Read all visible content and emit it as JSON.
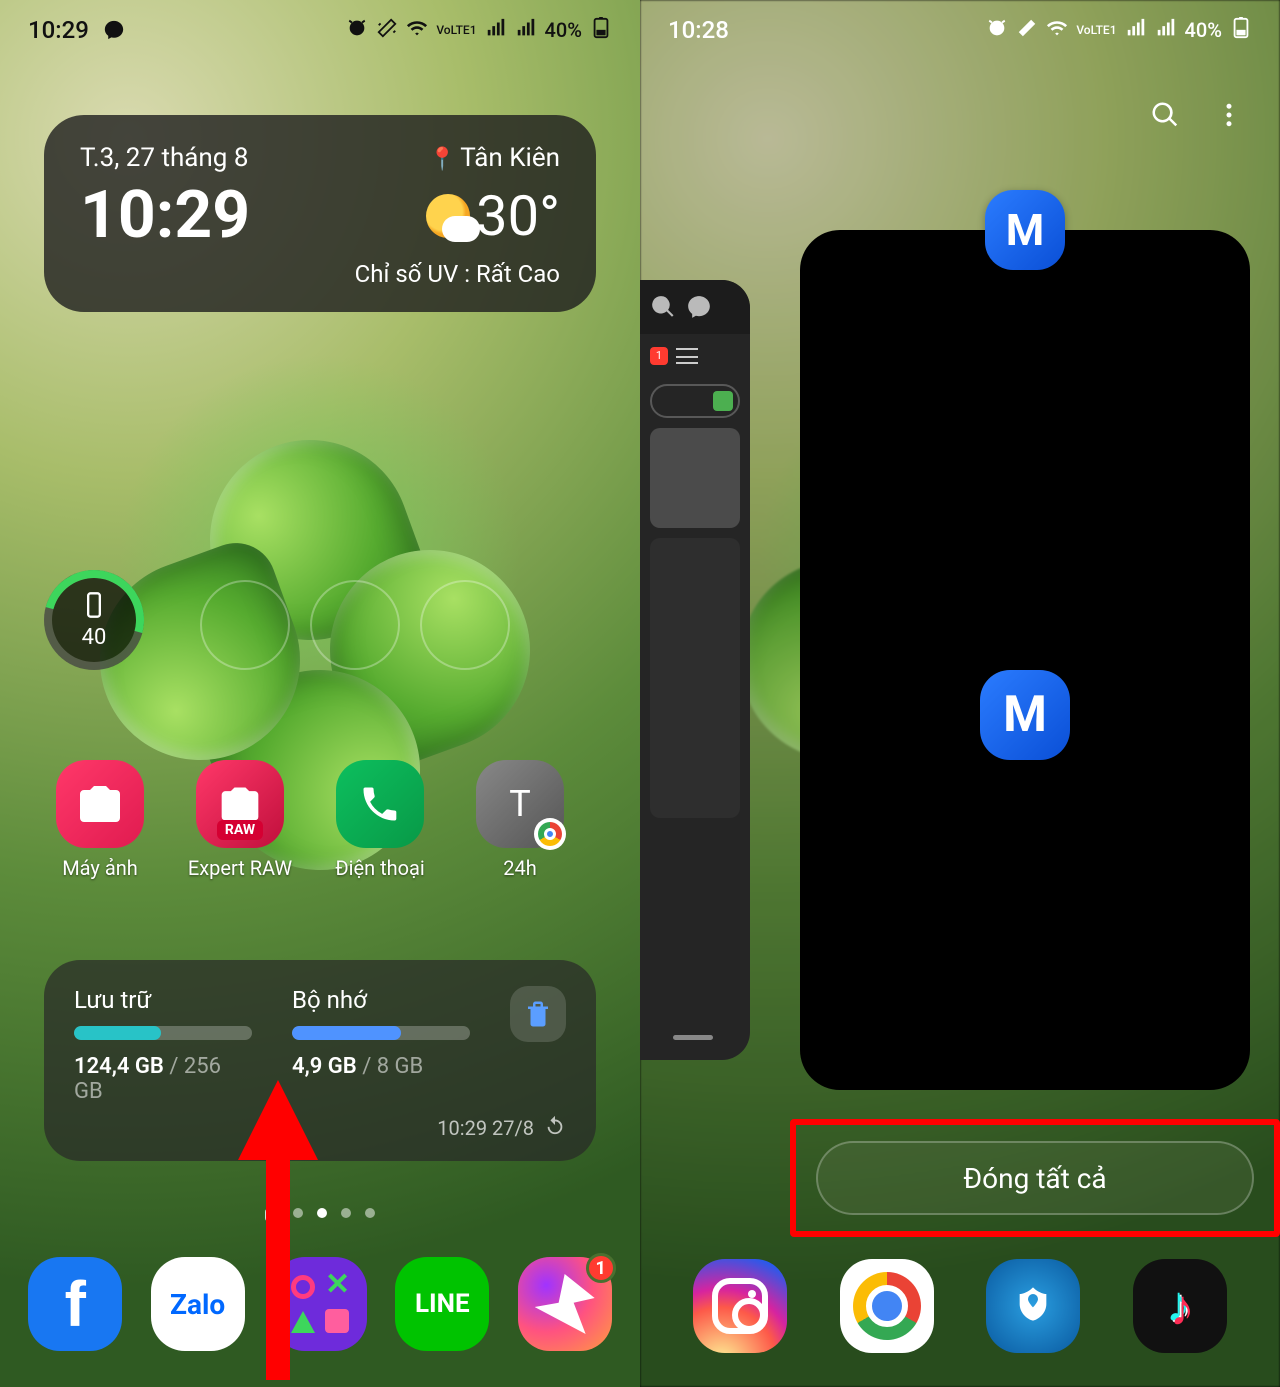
{
  "left": {
    "status": {
      "time": "10:29",
      "battery": "40%",
      "volte": "VoLTE1"
    },
    "weather": {
      "date": "T.3, 27 tháng 8",
      "location": "Tân Kiên",
      "time": "10:29",
      "temp": "30°",
      "uv_label": "Chỉ số UV : Rất Cao"
    },
    "device_widget": {
      "value": "40"
    },
    "apps": {
      "camera": "Máy ảnh",
      "raw": "Expert RAW",
      "raw_tag": "RAW",
      "phone": "Điện thoại",
      "news": "24h",
      "news_icon_text": "T"
    },
    "storage_widget": {
      "col1_title": "Lưu trữ",
      "col1_used": "124,4 GB",
      "col1_total": " / 256 GB",
      "col1_pct": 49,
      "col1_color": "#28c3c7",
      "col2_title": "Bộ nhớ",
      "col2_used": "4,9 GB",
      "col2_total": " / 8 GB",
      "col2_pct": 61,
      "col2_color": "#4f93ff",
      "timestamp": "10:29 27/8"
    },
    "dock": {
      "fb": "f",
      "zalo": "Zalo",
      "line": "LINE",
      "messenger_badge": "1"
    }
  },
  "right": {
    "status": {
      "time": "10:28",
      "battery": "40%",
      "volte": "VoLTE1"
    },
    "prev_card": {
      "badge": "1"
    },
    "app_letter": "M",
    "close_all": "Đóng tất cả"
  }
}
